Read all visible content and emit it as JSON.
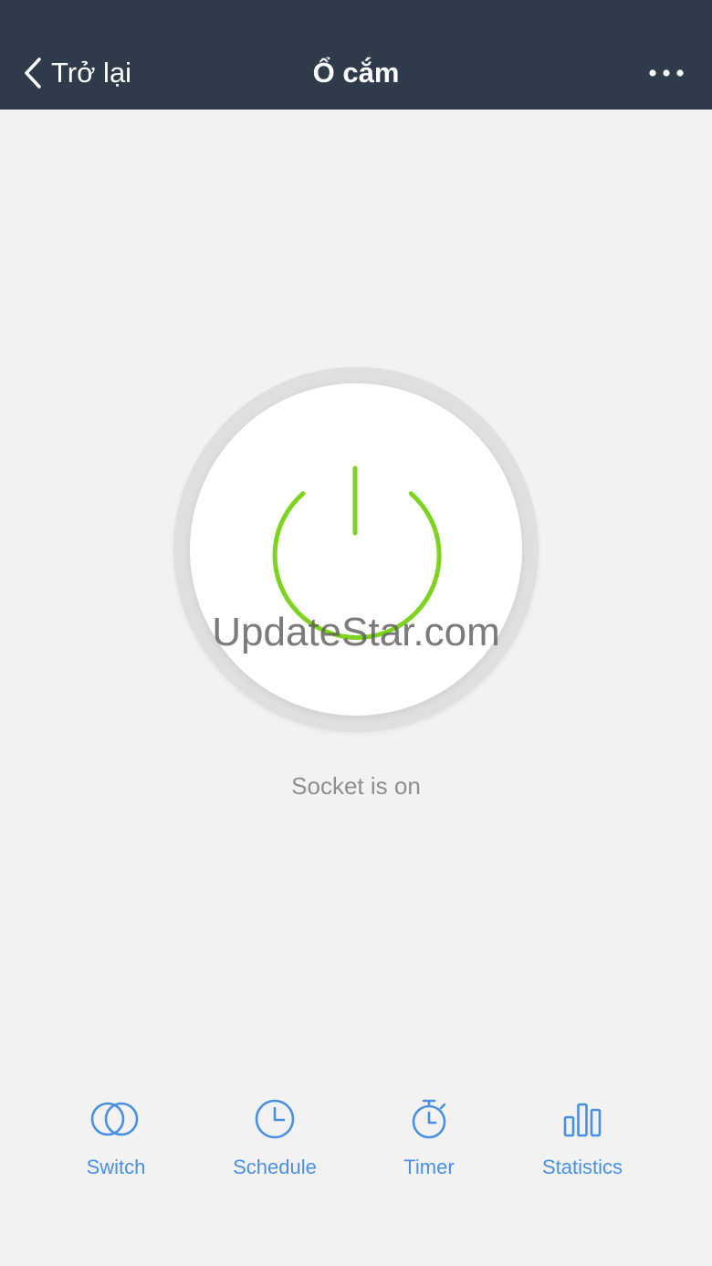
{
  "header": {
    "back_label": "Trở lại",
    "title": "Ổ cắm",
    "back_icon": "chevron-left-icon",
    "more_icon": "more-horizontal-icon"
  },
  "power": {
    "icon": "power-icon",
    "state": "on",
    "status_text": "Socket is on"
  },
  "watermark": "UpdateStar.com",
  "tabs": [
    {
      "label": "Switch",
      "icon": "switch-icon"
    },
    {
      "label": "Schedule",
      "icon": "clock-icon"
    },
    {
      "label": "Timer",
      "icon": "stopwatch-icon"
    },
    {
      "label": "Statistics",
      "icon": "bar-chart-icon"
    }
  ],
  "colors": {
    "header_bg": "#2f3a4b",
    "power_on": "#7ed321",
    "accent": "#4a90e2",
    "background": "#f2f2f2"
  }
}
